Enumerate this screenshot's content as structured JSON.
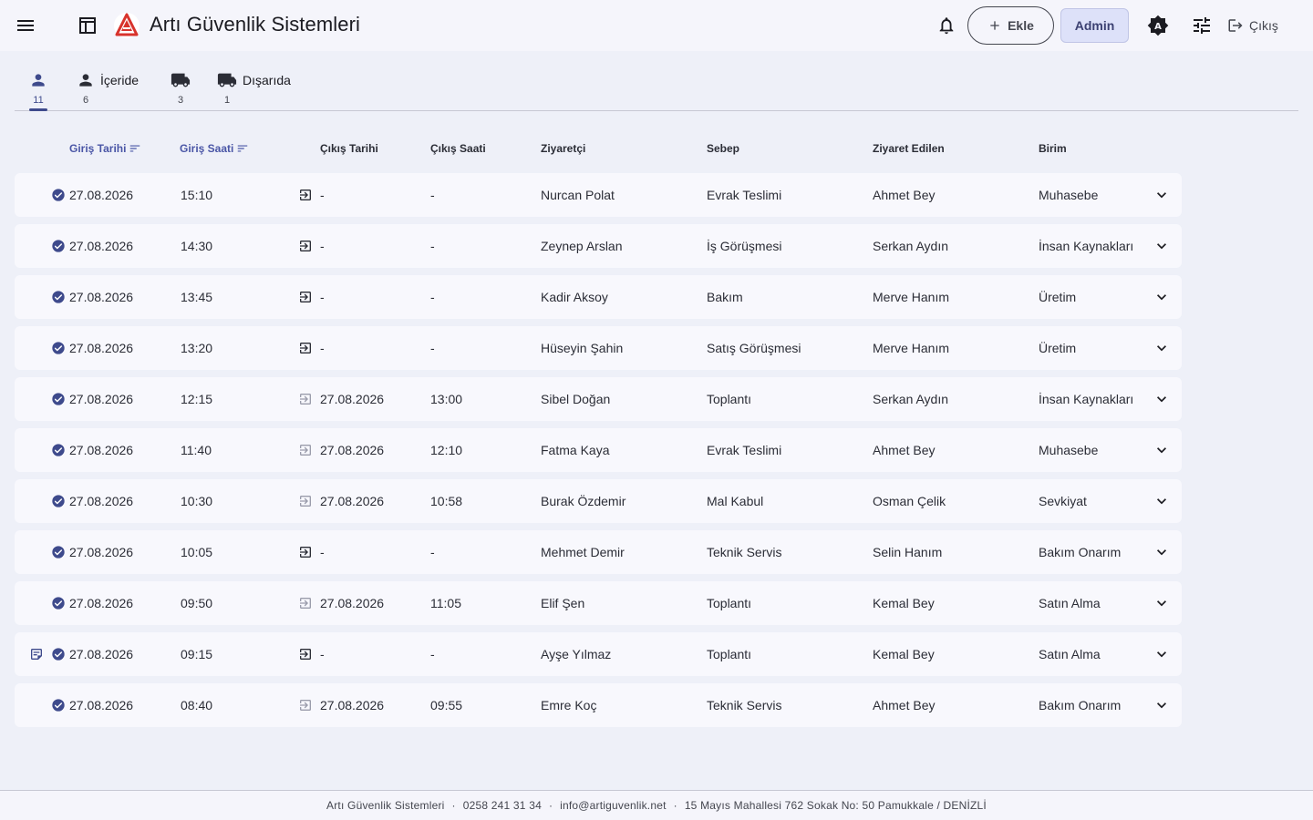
{
  "header": {
    "title": "Artı Güvenlik Sistemleri",
    "menu_icon": "menu-icon",
    "apps_icon": "table-layout-icon",
    "notifications_icon": "bell-icon",
    "add_label": "Ekle",
    "admin_label": "Admin",
    "theme_icon": "brightness-auto-icon",
    "settings_icon": "tune-icon",
    "logout_label": "Çıkış",
    "accent": "#3e4a8c"
  },
  "tabs": [
    {
      "label": "",
      "count": "11",
      "icon": "person-icon",
      "active": true
    },
    {
      "label": "İçeride",
      "count": "6",
      "icon": "person-icon",
      "active": false
    },
    {
      "label": "",
      "count": "3",
      "icon": "truck-icon",
      "active": false
    },
    {
      "label": "Dışarıda",
      "count": "1",
      "icon": "truck-icon",
      "active": false
    }
  ],
  "table": {
    "columns": {
      "entry_date": "Giriş Tarihi",
      "entry_time": "Giriş Saati",
      "exit_date": "Çıkış Tarihi",
      "exit_time": "Çıkış Saati",
      "visitor": "Ziyaretçi",
      "reason": "Sebep",
      "visited": "Ziyaret Edilen",
      "department": "Birim"
    },
    "sorted_columns": [
      "entry_date",
      "entry_time"
    ],
    "rows": [
      {
        "entry_date": "27.08.2026",
        "entry_time": "15:10",
        "exit_date": "-",
        "exit_time": "-",
        "visitor": "Nurcan Polat",
        "reason": "Evrak Teslimi",
        "visited": "Ahmet Bey",
        "department": "Muhasebe",
        "has_note": false,
        "inside": true
      },
      {
        "entry_date": "27.08.2026",
        "entry_time": "14:30",
        "exit_date": "-",
        "exit_time": "-",
        "visitor": "Zeynep Arslan",
        "reason": "İş Görüşmesi",
        "visited": "Serkan Aydın",
        "department": "İnsan Kaynakları",
        "has_note": false,
        "inside": true
      },
      {
        "entry_date": "27.08.2026",
        "entry_time": "13:45",
        "exit_date": "-",
        "exit_time": "-",
        "visitor": "Kadir Aksoy",
        "reason": "Bakım",
        "visited": "Merve Hanım",
        "department": "Üretim",
        "has_note": false,
        "inside": true
      },
      {
        "entry_date": "27.08.2026",
        "entry_time": "13:20",
        "exit_date": "-",
        "exit_time": "-",
        "visitor": "Hüseyin Şahin",
        "reason": "Satış Görüşmesi",
        "visited": "Merve Hanım",
        "department": "Üretim",
        "has_note": false,
        "inside": true
      },
      {
        "entry_date": "27.08.2026",
        "entry_time": "12:15",
        "exit_date": "27.08.2026",
        "exit_time": "13:00",
        "visitor": "Sibel Doğan",
        "reason": "Toplantı",
        "visited": "Serkan Aydın",
        "department": "İnsan Kaynakları",
        "has_note": false,
        "inside": false
      },
      {
        "entry_date": "27.08.2026",
        "entry_time": "11:40",
        "exit_date": "27.08.2026",
        "exit_time": "12:10",
        "visitor": "Fatma Kaya",
        "reason": "Evrak Teslimi",
        "visited": "Ahmet Bey",
        "department": "Muhasebe",
        "has_note": false,
        "inside": false
      },
      {
        "entry_date": "27.08.2026",
        "entry_time": "10:30",
        "exit_date": "27.08.2026",
        "exit_time": "10:58",
        "visitor": "Burak Özdemir",
        "reason": "Mal Kabul",
        "visited": "Osman Çelik",
        "department": "Sevkiyat",
        "has_note": false,
        "inside": false
      },
      {
        "entry_date": "27.08.2026",
        "entry_time": "10:05",
        "exit_date": "-",
        "exit_time": "-",
        "visitor": "Mehmet Demir",
        "reason": "Teknik Servis",
        "visited": "Selin Hanım",
        "department": "Bakım Onarım",
        "has_note": false,
        "inside": true
      },
      {
        "entry_date": "27.08.2026",
        "entry_time": "09:50",
        "exit_date": "27.08.2026",
        "exit_time": "11:05",
        "visitor": "Elif Şen",
        "reason": "Toplantı",
        "visited": "Kemal Bey",
        "department": "Satın Alma",
        "has_note": false,
        "inside": false
      },
      {
        "entry_date": "27.08.2026",
        "entry_time": "09:15",
        "exit_date": "-",
        "exit_time": "-",
        "visitor": "Ayşe Yılmaz",
        "reason": "Toplantı",
        "visited": "Kemal Bey",
        "department": "Satın Alma",
        "has_note": true,
        "inside": true
      },
      {
        "entry_date": "27.08.2026",
        "entry_time": "08:40",
        "exit_date": "27.08.2026",
        "exit_time": "09:55",
        "visitor": "Emre Koç",
        "reason": "Teknik Servis",
        "visited": "Ahmet Bey",
        "department": "Bakım Onarım",
        "has_note": false,
        "inside": false
      }
    ]
  },
  "footer": {
    "company": "Artı Güvenlik Sistemleri",
    "phone": "0258 241 31 34",
    "email": "info@artiguvenlik.net",
    "address": "15 Mayıs Mahallesi 762 Sokak No: 50 Pamukkale / DENİZLİ",
    "separator": "·"
  }
}
